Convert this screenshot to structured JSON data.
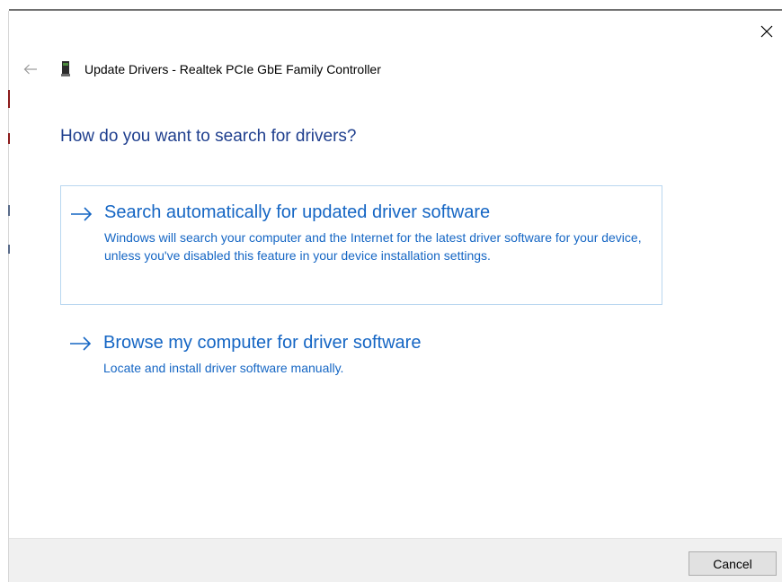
{
  "window": {
    "title": "Update Drivers - Realtek PCIe GbE Family Controller",
    "heading": "How do you want to search for drivers?"
  },
  "icons": {
    "close": "close-icon",
    "back": "back-arrow-icon",
    "device": "network-adapter-icon",
    "option_arrow": "right-arrow-icon"
  },
  "options": [
    {
      "title": "Search automatically for updated driver software",
      "description": "Windows will search your computer and the Internet for the latest driver software for your device, unless you've disabled this feature in your device installation settings."
    },
    {
      "title": "Browse my computer for driver software",
      "description": "Locate and install driver software manually."
    }
  ],
  "footer": {
    "cancel_label": "Cancel"
  },
  "colors": {
    "heading": "#1f3f8e",
    "link": "#1566c4",
    "selection_border": "#b9d7f0",
    "footer_bg": "#f0f0f0"
  }
}
